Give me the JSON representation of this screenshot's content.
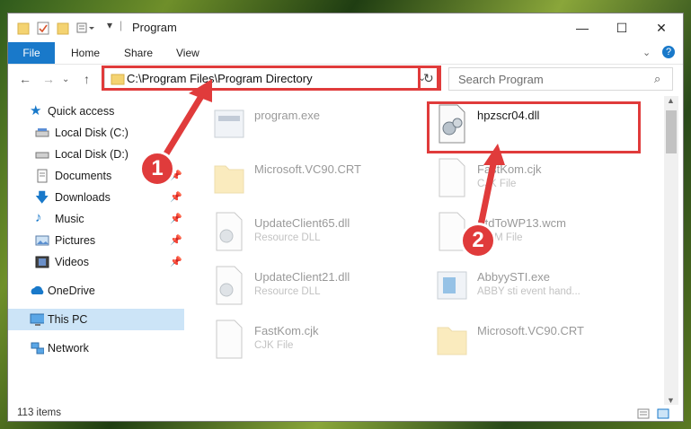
{
  "window": {
    "title": "Program",
    "controls": {
      "minimize": "—",
      "maximize": "☐",
      "close": "✕"
    }
  },
  "ribbon": {
    "tabs": [
      "File",
      "Home",
      "Share",
      "View"
    ],
    "help_icon": "?"
  },
  "address": {
    "path": "C:\\Program Files\\Program Directory",
    "search_placeholder": "Search Program"
  },
  "sidebar": {
    "items": [
      {
        "label": "Quick access",
        "icon": "star-icon",
        "pinned": false
      },
      {
        "label": "Local Disk (C:)",
        "icon": "drive-icon",
        "pinned": false
      },
      {
        "label": "Local Disk (D:)",
        "icon": "drive-icon",
        "pinned": false
      },
      {
        "label": "Documents",
        "icon": "documents-icon",
        "pinned": true
      },
      {
        "label": "Downloads",
        "icon": "download-icon",
        "pinned": true
      },
      {
        "label": "Music",
        "icon": "music-icon",
        "pinned": true
      },
      {
        "label": "Pictures",
        "icon": "pictures-icon",
        "pinned": true
      },
      {
        "label": "Videos",
        "icon": "videos-icon",
        "pinned": true
      },
      {
        "label": "OneDrive",
        "icon": "cloud-icon",
        "pinned": false
      },
      {
        "label": "This PC",
        "icon": "computer-icon",
        "pinned": false,
        "selected": true
      },
      {
        "label": "Network",
        "icon": "network-icon",
        "pinned": false
      }
    ]
  },
  "files": [
    {
      "name": "program.exe",
      "type": "",
      "icon": "exe-icon"
    },
    {
      "name": "hpzscr04.dll",
      "type": "",
      "icon": "dll-icon",
      "highlighted": true
    },
    {
      "name": "Microsoft.VC90.CRT",
      "type": "",
      "icon": "folder-icon"
    },
    {
      "name": "FastKom.cjk",
      "type": "CJK File",
      "icon": "file-icon"
    },
    {
      "name": "UpdateClient65.dll",
      "type": "Resource DLL",
      "icon": "dll-icon"
    },
    {
      "name": "StdToWP13.wcm",
      "type": "WCM File",
      "icon": "file-icon"
    },
    {
      "name": "UpdateClient21.dll",
      "type": "Resource DLL",
      "icon": "dll-icon"
    },
    {
      "name": "AbbyySTI.exe",
      "type": "ABBY sti event hand...",
      "icon": "exe-icon"
    },
    {
      "name": "FastKom.cjk",
      "type": "CJK File",
      "icon": "file-icon"
    },
    {
      "name": "Microsoft.VC90.CRT",
      "type": "",
      "icon": "folder-icon"
    }
  ],
  "status": {
    "item_count": "113 items"
  },
  "annotations": {
    "badge1": "1",
    "badge2": "2"
  },
  "colors": {
    "accent": "#1979ca",
    "highlight": "#e03b3b",
    "selected": "#cce4f7"
  }
}
